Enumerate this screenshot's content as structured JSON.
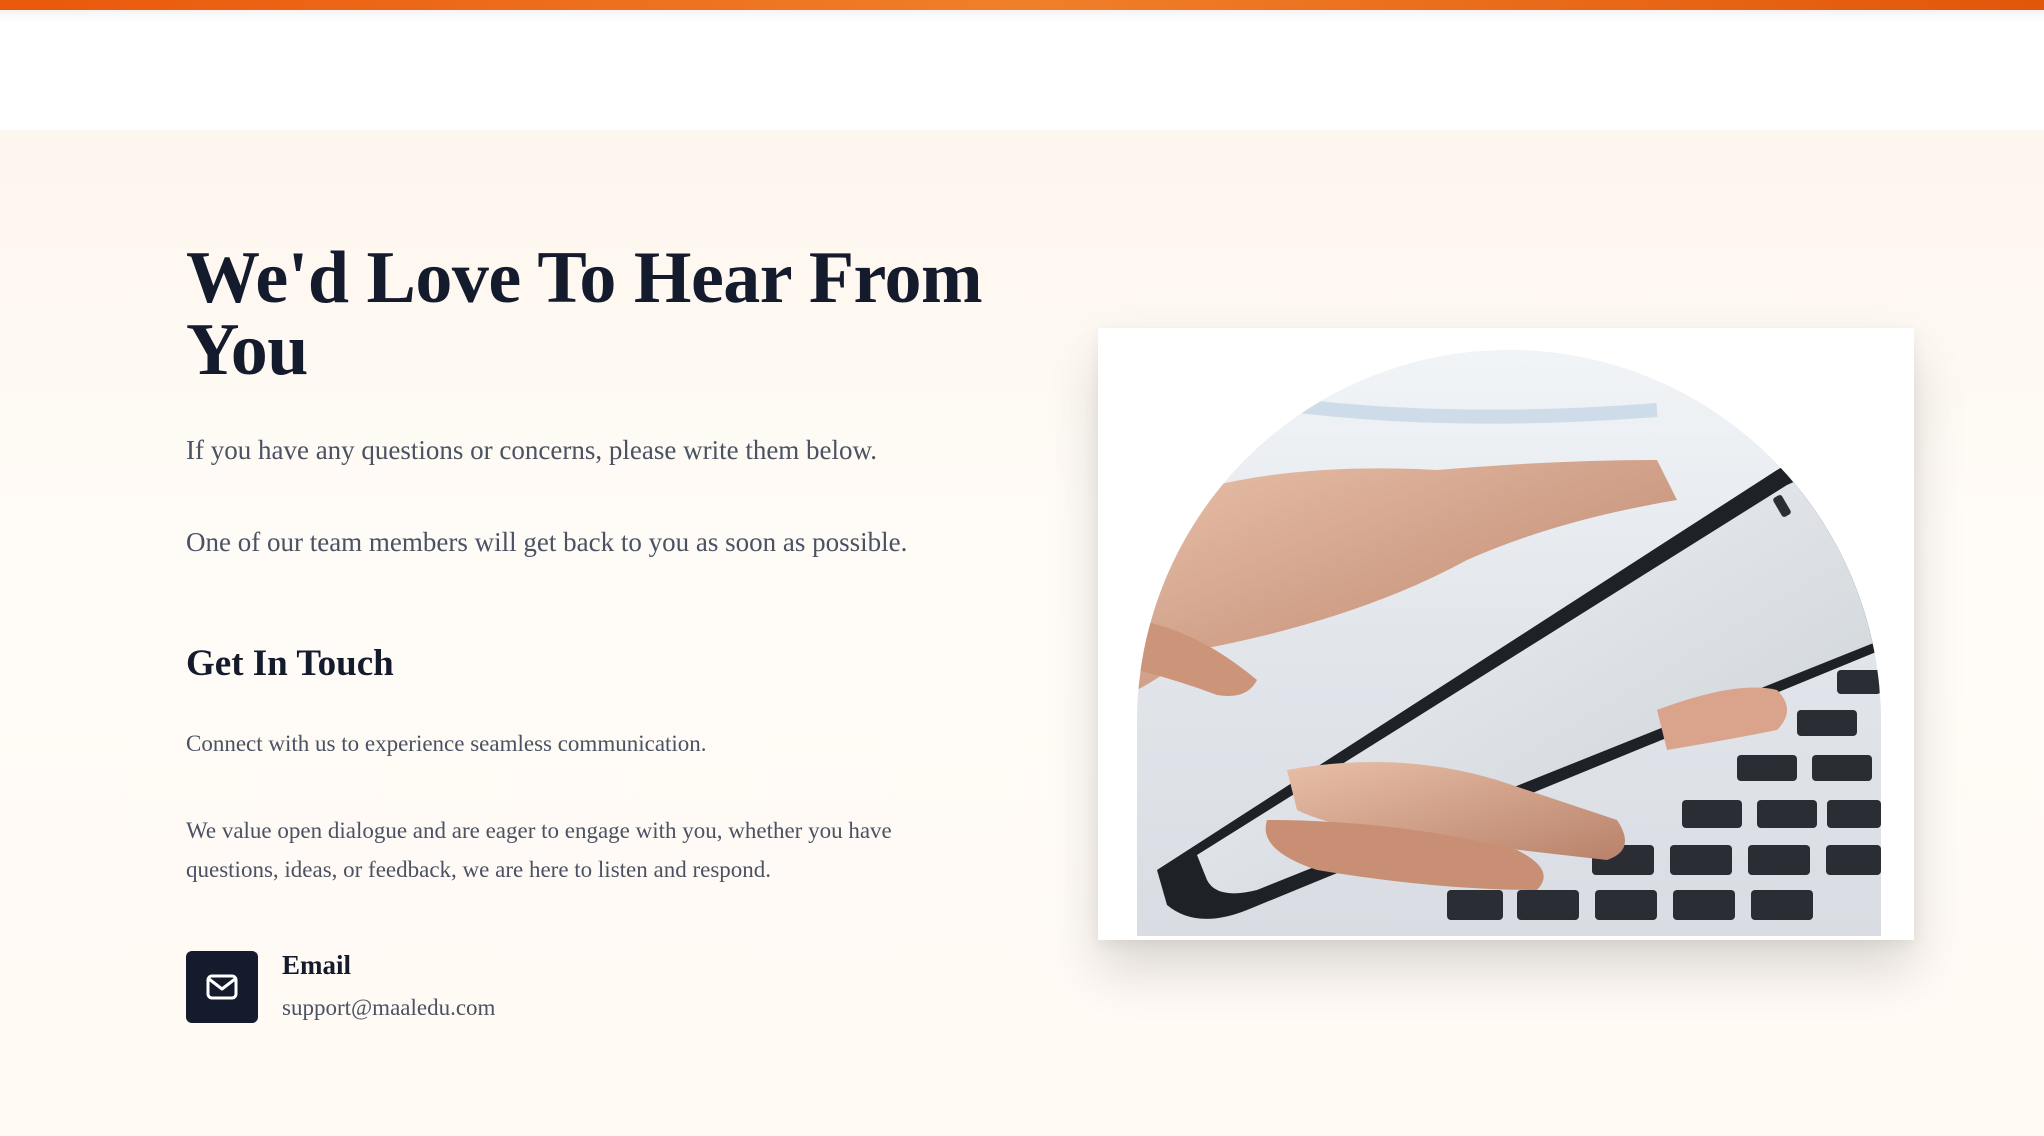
{
  "hero": {
    "heading": "We'd Love To Hear From You",
    "intro_1": "If you have any questions or concerns, please write them below.",
    "intro_2": "One of our team members will get back to you as soon as possible."
  },
  "contact": {
    "heading": "Get In Touch",
    "text_1": "Connect with us to experience seamless communication.",
    "text_2": "We value open dialogue and are eager to engage with you, whether you have questions, ideas, or feedback, we are here to listen and respond.",
    "email_label": "Email",
    "email_value": "support@maaledu.com",
    "email_icon": "mail-icon"
  },
  "image": {
    "subject": "hands-holding-smartphone-over-laptop-keyboard"
  },
  "colors": {
    "accent": "#ea580c",
    "heading": "#141b2d",
    "body": "#4a5263",
    "background": "#fdf6ee"
  }
}
